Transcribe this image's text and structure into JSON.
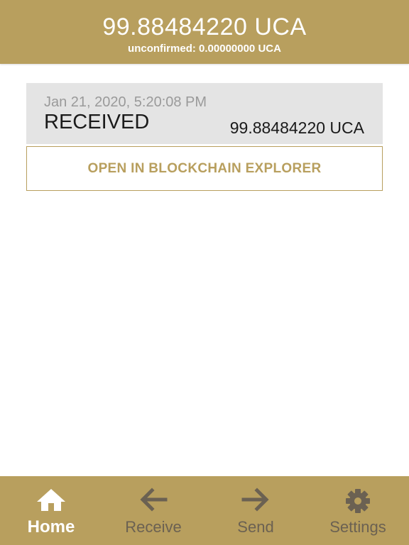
{
  "header": {
    "balance": "99.88484220 UCA",
    "unconfirmed": "unconfirmed: 0.00000000 UCA"
  },
  "transactions": [
    {
      "date": "Jan 21, 2020, 5:20:08 PM",
      "type": "RECEIVED",
      "amount": "99.88484220 UCA"
    }
  ],
  "explorer_button": {
    "label": "OPEN IN BLOCKCHAIN EXPLORER"
  },
  "bottom_nav": {
    "items": [
      {
        "label": "Home",
        "icon": "home-icon",
        "active": true
      },
      {
        "label": "Receive",
        "icon": "arrow-left-icon",
        "active": false
      },
      {
        "label": "Send",
        "icon": "arrow-right-icon",
        "active": false
      },
      {
        "label": "Settings",
        "icon": "gear-icon",
        "active": false
      }
    ]
  },
  "colors": {
    "brand": "#b89f5e",
    "card_background": "#e4e4e4",
    "nav_active": "#ffffff",
    "nav_inactive": "#6b6152"
  }
}
